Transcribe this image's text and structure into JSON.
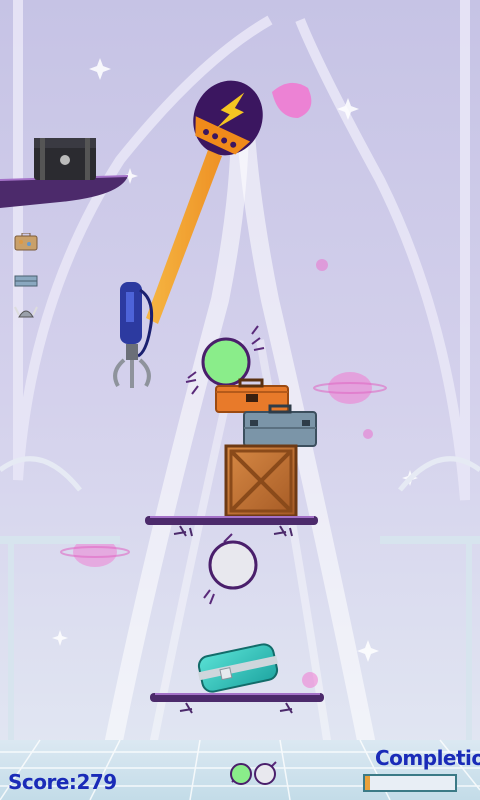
{
  "hud": {
    "score_label": "Score:",
    "score_value": "279",
    "completion_label": "Completion",
    "completion_fraction": 0.05,
    "remaining_orbs": [
      "green",
      "white"
    ]
  },
  "inventory": [
    {
      "icon": "suitcase-icon"
    },
    {
      "icon": "briefcase-icon"
    },
    {
      "icon": "viking-helmet-icon"
    }
  ],
  "palette": {
    "sky_top": "#c9c7e6",
    "sky_bottom": "#dfe6f2",
    "shelf": "#4c2a6b",
    "beam": "#f4a72a",
    "accent_pink": "#f07ad2",
    "text": "#1a2bb8"
  }
}
